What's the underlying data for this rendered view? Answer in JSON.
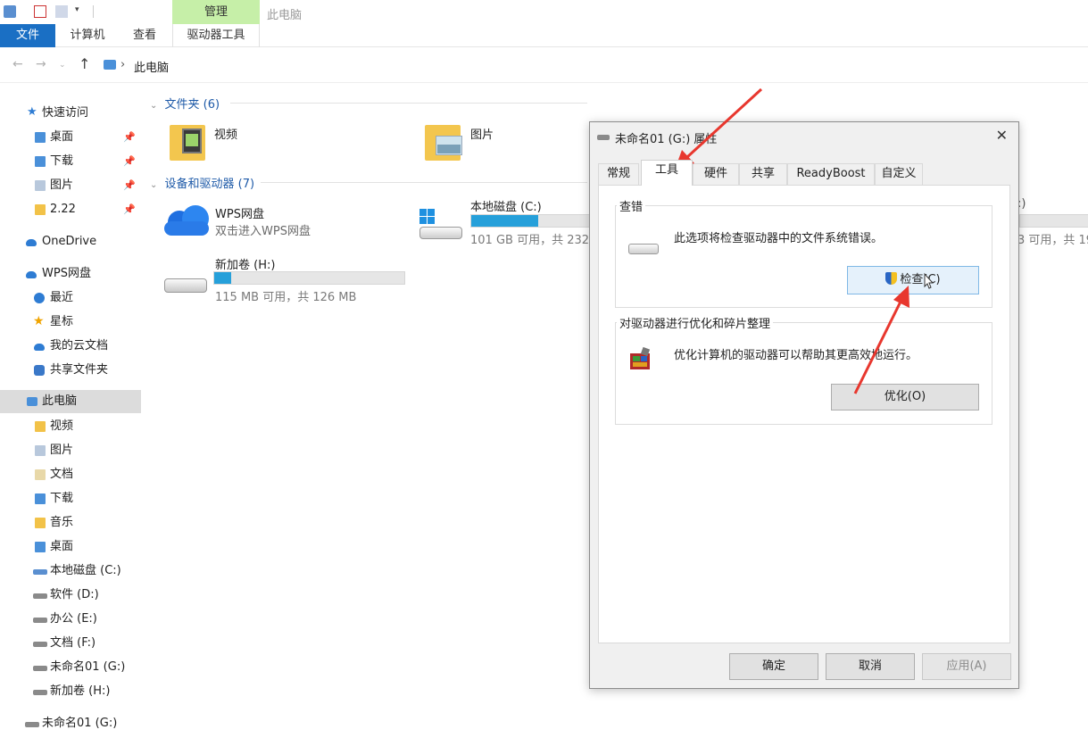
{
  "ribbon": {
    "context_tab": "管理",
    "title": "此电脑",
    "tabs": [
      "文件",
      "计算机",
      "查看",
      "驱动器工具"
    ]
  },
  "address": {
    "path": "此电脑"
  },
  "sidebar": {
    "items": [
      {
        "label": "快速访问",
        "icon": "star-icon"
      },
      {
        "label": "桌面",
        "icon": "folder-icon",
        "pinned": true
      },
      {
        "label": "下载",
        "icon": "download-folder-icon",
        "pinned": true
      },
      {
        "label": "图片",
        "icon": "pictures-folder-icon",
        "pinned": true
      },
      {
        "label": "2.22",
        "icon": "folder-icon",
        "pinned": true
      },
      {
        "label": "OneDrive",
        "icon": "cloud-icon"
      },
      {
        "label": "WPS网盘",
        "icon": "cloud-icon"
      },
      {
        "label": "最近",
        "icon": "clock-icon"
      },
      {
        "label": "星标",
        "icon": "star-icon"
      },
      {
        "label": "我的云文档",
        "icon": "cloud-icon"
      },
      {
        "label": "共享文件夹",
        "icon": "share-icon"
      },
      {
        "label": "此电脑",
        "icon": "computer-icon",
        "selected": true
      },
      {
        "label": "视频",
        "icon": "videos-folder-icon"
      },
      {
        "label": "图片",
        "icon": "pictures-folder-icon"
      },
      {
        "label": "文档",
        "icon": "documents-folder-icon"
      },
      {
        "label": "下载",
        "icon": "download-folder-icon"
      },
      {
        "label": "音乐",
        "icon": "music-folder-icon"
      },
      {
        "label": "桌面",
        "icon": "folder-icon"
      },
      {
        "label": "本地磁盘 (C:)",
        "icon": "drive-icon"
      },
      {
        "label": "软件 (D:)",
        "icon": "drive-icon"
      },
      {
        "label": "办公 (E:)",
        "icon": "drive-icon"
      },
      {
        "label": "文档 (F:)",
        "icon": "drive-icon"
      },
      {
        "label": "未命名01 (G:)",
        "icon": "drive-icon"
      },
      {
        "label": "新加卷 (H:)",
        "icon": "drive-icon"
      },
      {
        "label": "未命名01 (G:)",
        "icon": "drive-icon"
      }
    ]
  },
  "content": {
    "folders_header": "文件夹 (6)",
    "devices_header": "设备和驱动器 (7)",
    "folders": [
      {
        "label": "视频"
      },
      {
        "label": "图片"
      }
    ],
    "wps": {
      "title": "WPS网盘",
      "subtitle": "双击进入WPS网盘"
    },
    "drive_c": {
      "title": "本地磁盘 (C:)",
      "free": "101 GB 可用，共 232",
      "used_fraction": 0.57
    },
    "drive_h": {
      "title": "新加卷 (H:)",
      "free": "115 MB 可用，共 126 MB",
      "used_fraction": 0.09
    },
    "drive_right": {
      "title_fragment": ":)",
      "free_fragment": "3 可用，共 19"
    }
  },
  "dialog": {
    "title": "未命名01 (G:) 属性",
    "tabs": [
      "常规",
      "工具",
      "硬件",
      "共享",
      "ReadyBoost",
      "自定义"
    ],
    "active_tab": "工具",
    "check_group": {
      "label": "查错",
      "text": "此选项将检查驱动器中的文件系统错误。",
      "button": "检查(C)"
    },
    "optimize_group": {
      "label": "对驱动器进行优化和碎片整理",
      "text": "优化计算机的驱动器可以帮助其更高效地运行。",
      "button": "优化(O)"
    },
    "buttons": {
      "ok": "确定",
      "cancel": "取消",
      "apply": "应用(A)"
    }
  },
  "colors": {
    "accent": "#1a6fc4",
    "context_tab": "#c6efa8",
    "annotation_arrow": "#e8372e"
  }
}
